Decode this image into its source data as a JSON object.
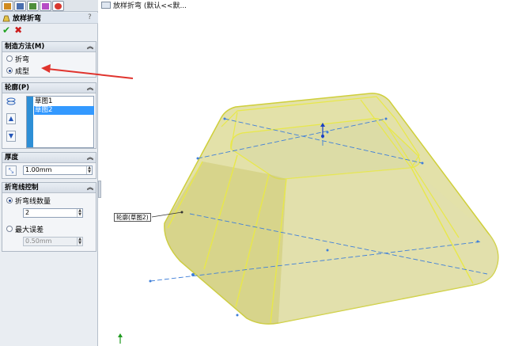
{
  "toolbar": {
    "tabs": [
      {
        "icon": "feature-manager-icon",
        "color": "#d08a1e"
      },
      {
        "icon": "property-manager-icon",
        "color": "#4a6fae"
      },
      {
        "icon": "configuration-icon",
        "color": "#4f8f3a"
      },
      {
        "icon": "dimxpert-icon",
        "color": "#b64cc5"
      },
      {
        "icon": "appearance-icon",
        "color": "#d8372e"
      }
    ]
  },
  "title": "放样折弯",
  "help": "?",
  "method": {
    "header": "制造方法(M)",
    "options": [
      {
        "label": "折弯",
        "selected": false
      },
      {
        "label": "成型",
        "selected": true
      }
    ]
  },
  "profile": {
    "header": "轮廓(P)",
    "items": [
      {
        "label": "草图1",
        "selected": false
      },
      {
        "label": "草图2",
        "selected": true
      }
    ]
  },
  "thickness": {
    "header": "厚度",
    "value": "1.00mm"
  },
  "bendline": {
    "header": "折弯线控制",
    "options": [
      {
        "label": "折弯线数量",
        "selected": true
      },
      {
        "label": "最大误差",
        "selected": false
      }
    ],
    "count_value": "2",
    "error_value": "0.50mm"
  },
  "breadcrumb": "放样折弯 (默认<<默...",
  "callout": "轮廓(草图2)",
  "colors": {
    "panel": "#e9edf2",
    "part_fill": "#d9d78c",
    "edge": "#e8e84a",
    "arrow": "#e0342e",
    "centerline": "#3f7fd9"
  }
}
